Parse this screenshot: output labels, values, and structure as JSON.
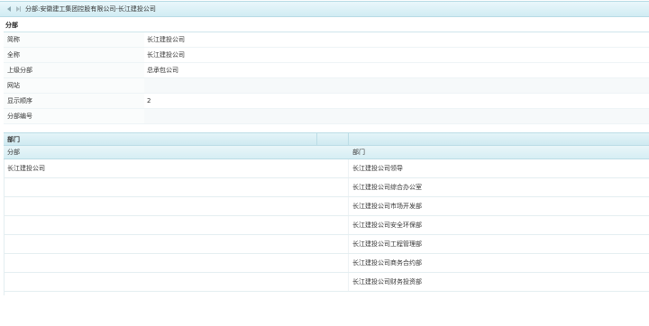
{
  "titlebar": {
    "title": "分部:安徽建工集团控股有限公司-长江建投公司",
    "icons": [
      "back-arrow-icon",
      "forward-arrow-icon"
    ]
  },
  "section": {
    "heading": "分部"
  },
  "details": [
    {
      "label": "简称",
      "value": "长江建投公司"
    },
    {
      "label": "全称",
      "value": "长江建投公司"
    },
    {
      "label": "上级分部",
      "value": "总承包公司"
    },
    {
      "label": "网站",
      "value": ""
    },
    {
      "label": "显示顺序",
      "value": "2"
    },
    {
      "label": "分部编号",
      "value": ""
    }
  ],
  "table": {
    "group_header": "部门",
    "columns": [
      "分部",
      "部门"
    ],
    "rows": [
      {
        "subcompany": "长江建投公司",
        "department": "长江建投公司领导"
      },
      {
        "subcompany": "",
        "department": "长江建投公司综合办公室"
      },
      {
        "subcompany": "",
        "department": "长江建投公司市场开发部"
      },
      {
        "subcompany": "",
        "department": "长江建投公司安全环保部"
      },
      {
        "subcompany": "",
        "department": "长江建投公司工程管理部"
      },
      {
        "subcompany": "",
        "department": "长江建投公司商务合约部"
      },
      {
        "subcompany": "",
        "department": "长江建投公司财务投资部"
      }
    ]
  }
}
